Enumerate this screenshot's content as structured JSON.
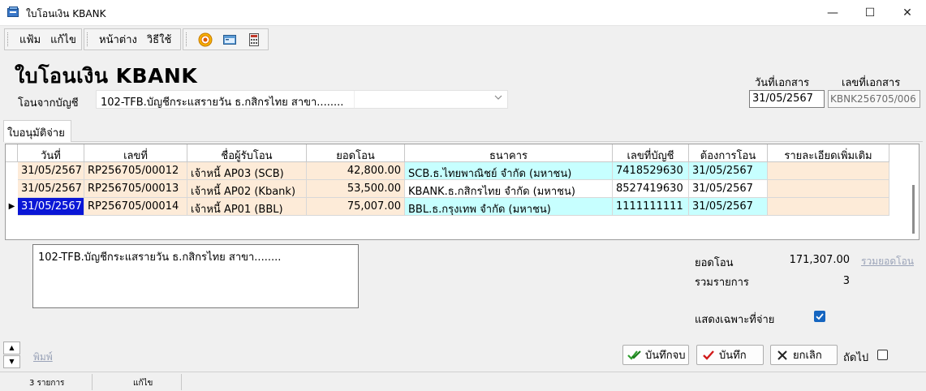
{
  "window": {
    "title": "ใบโอนเงิน KBANK",
    "minimize": "—",
    "maximize": "☐",
    "close": "✕"
  },
  "menu": {
    "file": "แฟ้ม",
    "edit": "แก้ไข",
    "window": "หน้าต่าง",
    "help": "วิธีใช้"
  },
  "toolbar_icons": [
    "target-icon",
    "window-icon",
    "calculator-icon"
  ],
  "header": {
    "heading": "ใบโอนเงิน KBANK",
    "from_account_label": "โอนจากบัญชี",
    "from_account_value": "102-TFB.บัญชีกระแสรายวัน ธ.กสิกรไทย สาขา........",
    "doc_date_label": "วันที่เอกสาร",
    "doc_date": "31/05/2567",
    "doc_no_label": "เลขที่เอกสาร",
    "doc_no": "KBNK256705/006"
  },
  "tab": {
    "label": "ใบอนุมัติจ่าย"
  },
  "grid": {
    "columns": [
      "วันที่",
      "เลขที่",
      "ชื่อผู้รับโอน",
      "ยอดโอน",
      "ธนาคาร",
      "เลขที่บัญชี",
      "ต้องการโอน",
      "รายละเอียดเพิ่มเติม"
    ],
    "rows": [
      [
        "31/05/2567",
        "RP256705/00012",
        "เจ้าหนี้ AP03 (SCB)",
        "42,800.00",
        "SCB.ธ.ไทยพาณิชย์ จำกัด (มหาชน)",
        "7418529630",
        "31/05/2567",
        ""
      ],
      [
        "31/05/2567",
        "RP256705/00013",
        "เจ้าหนี้ AP02 (Kbank)",
        "53,500.00",
        "KBANK.ธ.กสิกรไทย จำกัด (มหาชน)",
        "8527419630",
        "31/05/2567",
        ""
      ],
      [
        "31/05/2567",
        "RP256705/00014",
        "เจ้าหนี้ AP01 (BBL)",
        "75,007.00",
        "BBL.ธ.กรุงเทพ จำกัด (มหาชน)",
        "1111111111",
        "31/05/2567",
        ""
      ]
    ],
    "current_row_marker": "▶"
  },
  "memo": "102-TFB.บัญชีกระแสรายวัน ธ.กสิกรไทย สาขา........",
  "summary": {
    "transfer_label": "ยอดโอน",
    "transfer_total": "171,307.00",
    "total_link": "รวมยอดโอน",
    "count_label": "รวมรายการ",
    "count": "3",
    "paid_only_label": "แสดงเฉพาะที่จ่าย",
    "paid_only_checked": true
  },
  "footer": {
    "spin_up": "▲",
    "spin_down": "▼",
    "print_link": "พิมพ์",
    "save_close": "บันทึกจบ",
    "save": "บันทึก",
    "cancel": "ยกเลิก",
    "next_label": "ถัดไป",
    "next_checked": false
  },
  "statusbar": {
    "records": "3 รายการ",
    "mode": "แก้ไข"
  },
  "colors": {
    "row_peach": "#fdebd8",
    "row_cyan": "#c7ffff",
    "selection": "#0a16d6",
    "check_blue": "#1565c0"
  }
}
